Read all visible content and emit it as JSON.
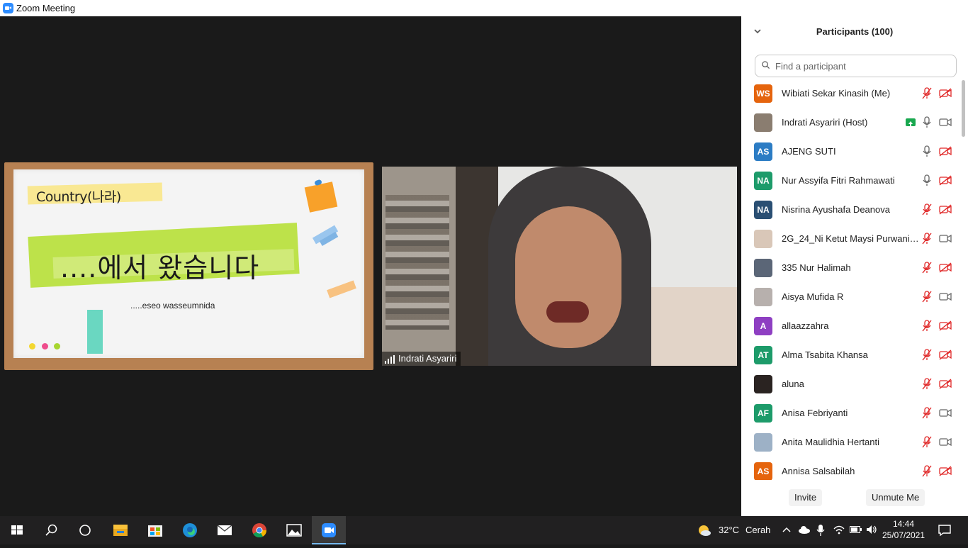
{
  "window": {
    "title": "Zoom Meeting",
    "minimize_glyph": "—",
    "maximize_glyph": "❐",
    "close_glyph": "✕"
  },
  "share": {
    "country_label": "Country(나라)",
    "korean_text": "....에서 왔습니다",
    "romanized_text": ".....eseo wasseumnida"
  },
  "video": {
    "participant_name": "Indrati Asyariri"
  },
  "panel": {
    "title": "Participants (100)",
    "collapse_glyph": "⌄",
    "search_placeholder": "Find a participant",
    "participants": [
      {
        "initials": "WS",
        "avatar_color": "#e5640d",
        "name": "Wibiati Sekar Kinasih (Me)",
        "mic": "muted",
        "video": "off"
      },
      {
        "initials": "",
        "avatar_color": "#8a7d70",
        "name": "Indrati Asyariri (Host)",
        "mic": "on",
        "video": "on",
        "sharing": true
      },
      {
        "initials": "AS",
        "avatar_color": "#2c7cc4",
        "name": "AJENG SUTI",
        "mic": "on",
        "video": "off"
      },
      {
        "initials": "NA",
        "avatar_color": "#1d9b6a",
        "name": "Nur Assyifa Fitri Rahmawati",
        "mic": "on",
        "video": "off"
      },
      {
        "initials": "NA",
        "avatar_color": "#2a4f73",
        "name": "Nisrina Ayushafa Deanova",
        "mic": "muted",
        "video": "off"
      },
      {
        "initials": "",
        "avatar_color": "#d9c7b8",
        "name": "2G_24_Ni Ketut Maysi Purwanin...",
        "mic": "muted",
        "video": "on"
      },
      {
        "initials": "",
        "avatar_color": "#5b6677",
        "name": "335 Nur Halimah",
        "mic": "muted",
        "video": "off"
      },
      {
        "initials": "",
        "avatar_color": "#b7b0ad",
        "name": "Aisya Mufida R",
        "mic": "muted",
        "video": "on"
      },
      {
        "initials": "A",
        "avatar_color": "#8e3fc2",
        "name": "allaazzahra",
        "mic": "muted",
        "video": "off"
      },
      {
        "initials": "AT",
        "avatar_color": "#1d9b6a",
        "name": "Alma Tsabita Khansa",
        "mic": "muted",
        "video": "off"
      },
      {
        "initials": "",
        "avatar_color": "#2a2321",
        "name": "aluna",
        "mic": "muted",
        "video": "off"
      },
      {
        "initials": "AF",
        "avatar_color": "#1d9b6a",
        "name": "Anisa Febriyanti",
        "mic": "muted",
        "video": "on"
      },
      {
        "initials": "",
        "avatar_color": "#9db1c6",
        "name": "Anita Maulidhia Hertanti",
        "mic": "muted",
        "video": "on"
      },
      {
        "initials": "AS",
        "avatar_color": "#e5640d",
        "name": "Annisa Salsabilah",
        "mic": "muted",
        "video": "off"
      }
    ],
    "invite_label": "Invite",
    "unmute_label": "Unmute Me"
  },
  "taskbar": {
    "weather_temp": "32°C",
    "weather_text": "Cerah",
    "time": "14:44",
    "date": "25/07/2021",
    "icons": [
      "windows-start-icon",
      "search-icon",
      "task-view-icon",
      "file-explorer-icon",
      "microsoft-store-icon",
      "edge-icon",
      "mail-icon",
      "chrome-icon",
      "photos-icon",
      "zoom-icon"
    ]
  },
  "colors": {
    "muted_red": "#e02828",
    "zoom_blue": "#2d8cff",
    "share_green": "#19a84f"
  }
}
